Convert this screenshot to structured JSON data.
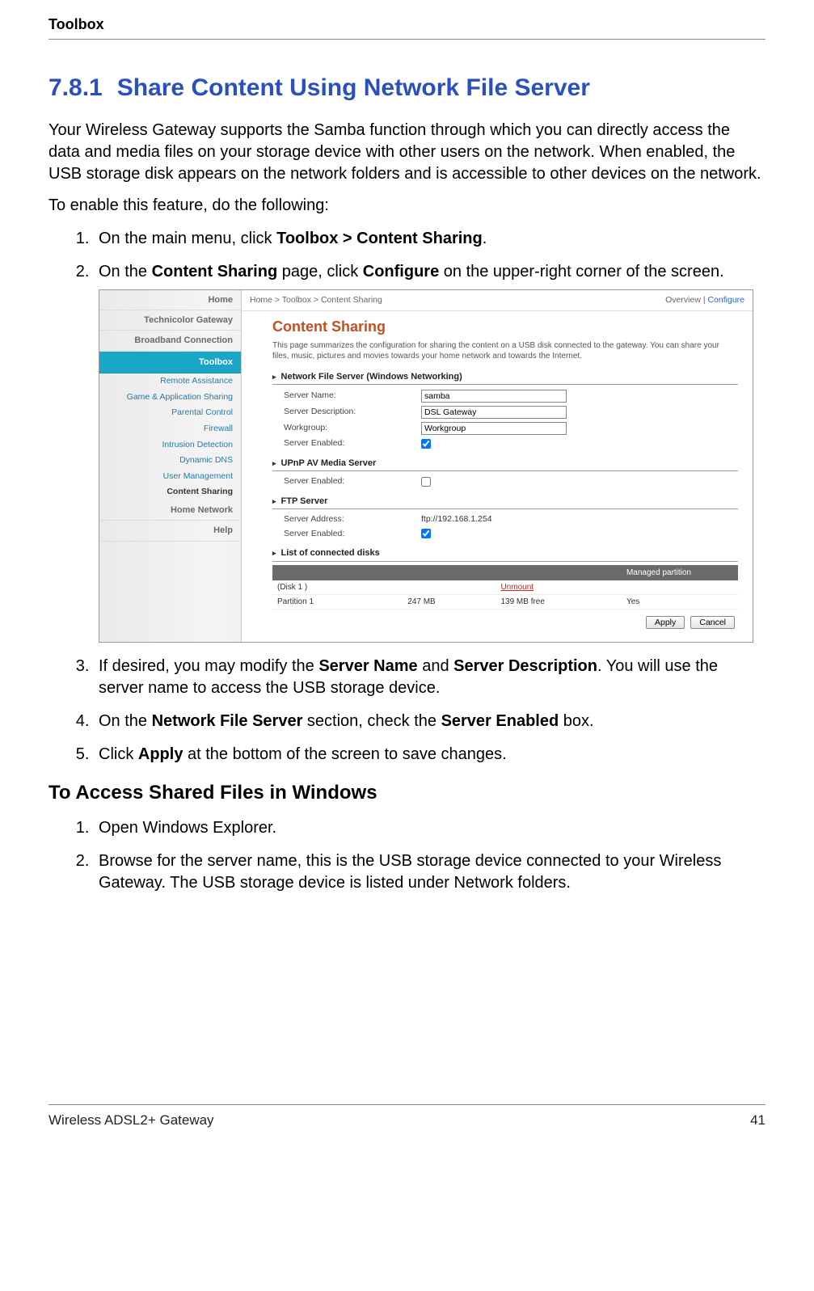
{
  "header": {
    "title": "Toolbox"
  },
  "section": {
    "number": "7.8.1",
    "title": "Share Content Using Network File Server",
    "intro": "Your Wireless Gateway supports the Samba function through which you can directly access the data and media files on your storage device with other users on the network. When enabled, the USB storage disk appears on the network folders and is accessible to other devices on the network.",
    "lead": "To enable this feature, do the following:"
  },
  "steps": {
    "s1_pre": "On the main menu, click ",
    "s1_bold": "Toolbox > Content Sharing",
    "s1_post": ".",
    "s2_pre": "On the ",
    "s2_b1": "Content Sharing",
    "s2_mid": " page, click ",
    "s2_b2": "Configure",
    "s2_post": " on the upper-right corner of the screen.",
    "s3_pre": "If desired, you may modify the ",
    "s3_b1": "Server Name",
    "s3_mid": " and ",
    "s3_b2": "Server Description",
    "s3_post": ". You will use the server name to access the USB storage device.",
    "s4_pre": "On the ",
    "s4_b1": "Network File Server",
    "s4_mid": " section, check the ",
    "s4_b2": "Server Enabled",
    "s4_post": " box.",
    "s5_pre": "Click ",
    "s5_b1": "Apply",
    "s5_post": " at the bottom of the screen to save changes."
  },
  "sub": {
    "heading": "To Access Shared Files in Windows",
    "w1": "Open Windows Explorer.",
    "w2": "Browse for the server name, this is the USB storage device connected to your Wireless Gateway. The USB storage device is listed under Network folders."
  },
  "footer": {
    "left": "Wireless ADSL2+ Gateway",
    "right": "41"
  },
  "screenshot": {
    "nav": {
      "home": "Home",
      "tech": "Technicolor Gateway",
      "broadband": "Broadband Connection",
      "toolbox": "Toolbox",
      "sub": {
        "remote": "Remote Assistance",
        "game": "Game & Application Sharing",
        "parental": "Parental Control",
        "firewall": "Firewall",
        "intrusion": "Intrusion Detection",
        "ddns": "Dynamic DNS",
        "usermgmt": "User Management",
        "content": "Content Sharing"
      },
      "homenet": "Home Network",
      "help": "Help"
    },
    "breadcrumb": "Home > Toolbox > Content Sharing",
    "links": {
      "overview": "Overview",
      "sep": " | ",
      "configure": "Configure"
    },
    "title": "Content Sharing",
    "desc": "This page summarizes the configuration for sharing the content on a USB disk connected to the gateway. You can share your files, music, pictures and movies towards your home network and towards the Internet.",
    "groups": {
      "nfs": {
        "heading": "Network File Server (Windows Networking)",
        "server_name_lbl": "Server Name:",
        "server_name_val": "samba",
        "server_desc_lbl": "Server Description:",
        "server_desc_val": "DSL Gateway",
        "workgroup_lbl": "Workgroup:",
        "workgroup_val": "Workgroup",
        "enabled_lbl": "Server Enabled:",
        "enabled_val": true
      },
      "upnp": {
        "heading": "UPnP AV Media Server",
        "enabled_lbl": "Server Enabled:",
        "enabled_val": false
      },
      "ftp": {
        "heading": "FTP Server",
        "addr_lbl": "Server Address:",
        "addr_val": "ftp://192.168.1.254",
        "enabled_lbl": "Server Enabled:",
        "enabled_val": true
      },
      "disks": {
        "heading": "List of connected disks",
        "col_managed": "Managed partition",
        "row1_name": "(Disk 1 )",
        "row1_action": "Unmount",
        "row2_name": "Partition 1",
        "row2_size": "247 MB",
        "row2_free": "139 MB free",
        "row2_managed": "Yes"
      }
    },
    "buttons": {
      "apply": "Apply",
      "cancel": "Cancel"
    }
  }
}
